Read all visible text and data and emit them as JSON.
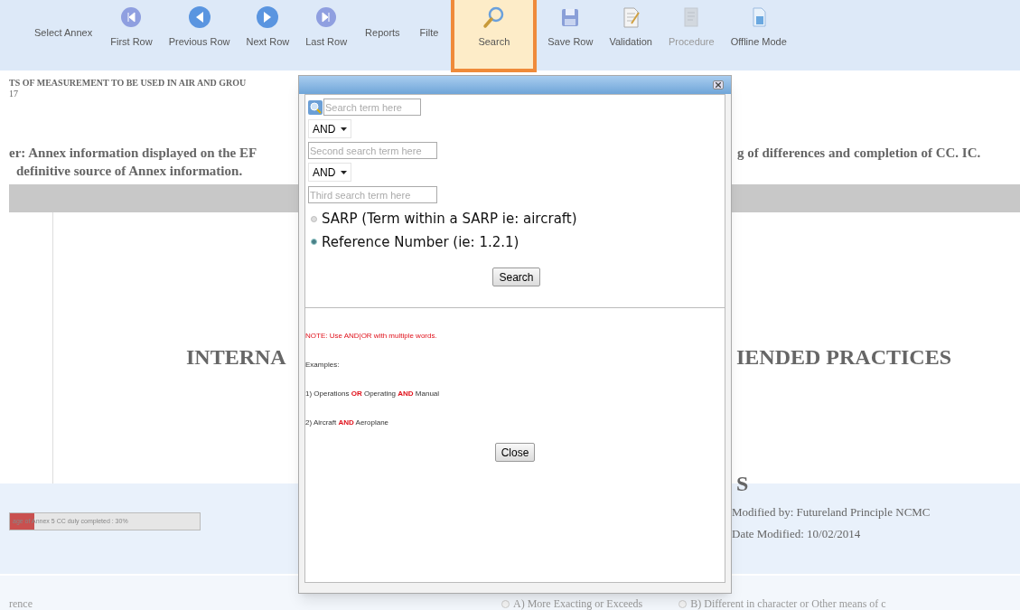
{
  "toolbar": [
    {
      "kind": "text",
      "label": "Select Annex"
    },
    {
      "kind": "button",
      "label": "First Row",
      "selected": false,
      "disabled": false
    },
    {
      "kind": "button",
      "label": "Previous Row",
      "selected": false,
      "disabled": false
    },
    {
      "kind": "button",
      "label": "Next Row",
      "selected": false,
      "disabled": false
    },
    {
      "kind": "button",
      "label": "Last Row",
      "selected": false,
      "disabled": false
    },
    {
      "kind": "text",
      "label": "Reports"
    },
    {
      "kind": "text",
      "label": "Filte"
    },
    {
      "kind": "button",
      "label": "Search",
      "selected": true,
      "disabled": false
    },
    {
      "kind": "button",
      "label": "Save Row",
      "selected": false,
      "disabled": false
    },
    {
      "kind": "button",
      "label": "Validation",
      "selected": false,
      "disabled": false
    },
    {
      "kind": "button",
      "label": "Procedure",
      "selected": false,
      "disabled": true
    },
    {
      "kind": "button",
      "label": "Offline Mode",
      "selected": false,
      "disabled": false
    }
  ],
  "page": {
    "title_line": "TS OF MEASUREMENT TO BE USED IN AIR AND GROU",
    "number": "17",
    "disclaimer_left": "er: Annex information displayed on the EF",
    "disclaimer_right": "g of differences and completion of CC. IC.",
    "disclaimer_line2": "definitive source of Annex information.",
    "heading_left": "INTERNA",
    "heading_right": "IENDED PRACTICES",
    "heading2_right": "S",
    "progress": {
      "text": "age of Annex 5 CC duly completed : 30%",
      "level": 0.13
    },
    "modified_by": "Modified by: Futureland Principle NCMC",
    "date_modified": "Date Modified: 10/02/2014",
    "bottom_left": "rence",
    "options": [
      {
        "label": "A) More Exacting or Exceeds",
        "selected": false
      },
      {
        "label": "B) Different in character or Other means of c",
        "selected": false
      }
    ]
  },
  "dialog": {
    "term1_placeholder": "Search term here",
    "operator1": "AND",
    "term2_placeholder": "Second search term here",
    "operator2": "AND",
    "term3_placeholder": "Third search term here",
    "modes": [
      {
        "label": "SARP (Term within a SARP ie: aircraft)",
        "selected": false
      },
      {
        "label": "Reference Number (ie: 1.2.1)",
        "selected": true
      }
    ],
    "search_button": "Search",
    "note": "NOTE: Use AND|OR with multiple words.",
    "examples_label": "Examples:",
    "examples": [
      "1) Operations **OR** Operating **AND** Manual",
      "2) Aircraft **AND** Aeroplane"
    ],
    "close_button": "Close"
  }
}
